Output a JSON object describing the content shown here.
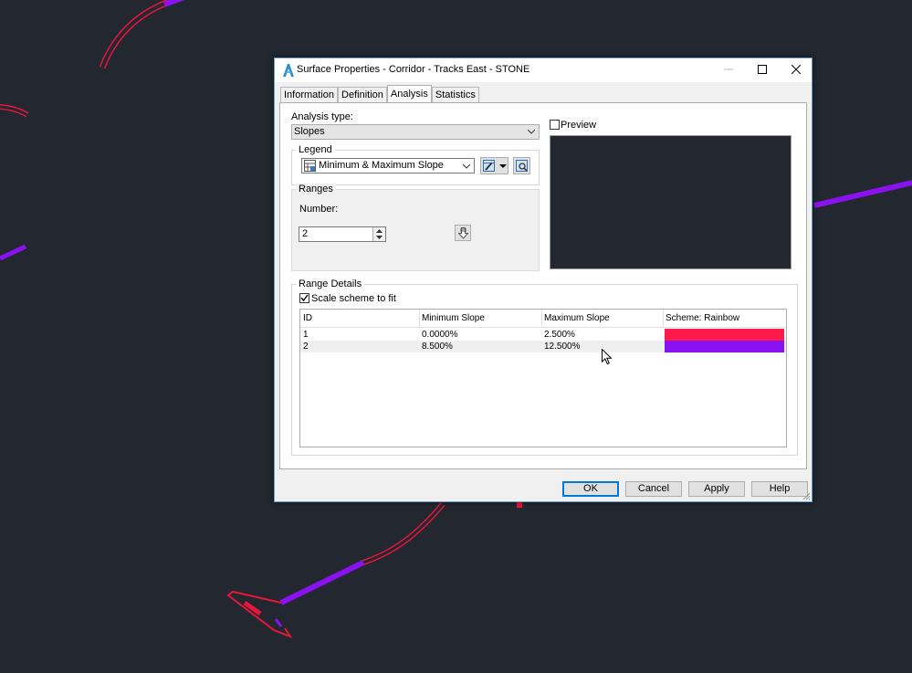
{
  "colors": {
    "canvas_bg": "#222730",
    "curve_red": "#e8163a",
    "curve_purple": "#8a12f0",
    "range_1": "#ff1a4b",
    "range_2": "#8b12f0"
  },
  "dialog": {
    "title": "Surface Properties - Corridor - Tracks East - STONE",
    "icon": "autocad-civil-icon",
    "tabs": [
      {
        "label": "Information"
      },
      {
        "label": "Definition"
      },
      {
        "label": "Analysis"
      },
      {
        "label": "Statistics"
      }
    ],
    "active_tab": "Analysis",
    "analysis_type": {
      "label": "Analysis type:",
      "value": "Slopes"
    },
    "preview": {
      "label": "Preview",
      "checked": false
    },
    "legend": {
      "group_label": "Legend",
      "value": "Minimum & Maximum Slope"
    },
    "ranges": {
      "group_label": "Ranges",
      "number_label": "Number:",
      "number_value": "2"
    },
    "range_details": {
      "group_label": "Range Details",
      "scale_scheme_label": "Scale scheme to fit",
      "scale_scheme_checked": true,
      "columns": [
        "ID",
        "Minimum Slope",
        "Maximum Slope",
        "Scheme: Rainbow"
      ],
      "rows": [
        {
          "id": "1",
          "min": "0.0000%",
          "max": "2.500%",
          "color": "#ff1a4b"
        },
        {
          "id": "2",
          "min": "8.500%",
          "max": "12.500%",
          "color": "#8b12f0"
        }
      ]
    },
    "buttons": {
      "ok": "OK",
      "cancel": "Cancel",
      "apply": "Apply",
      "help": "Help"
    }
  }
}
